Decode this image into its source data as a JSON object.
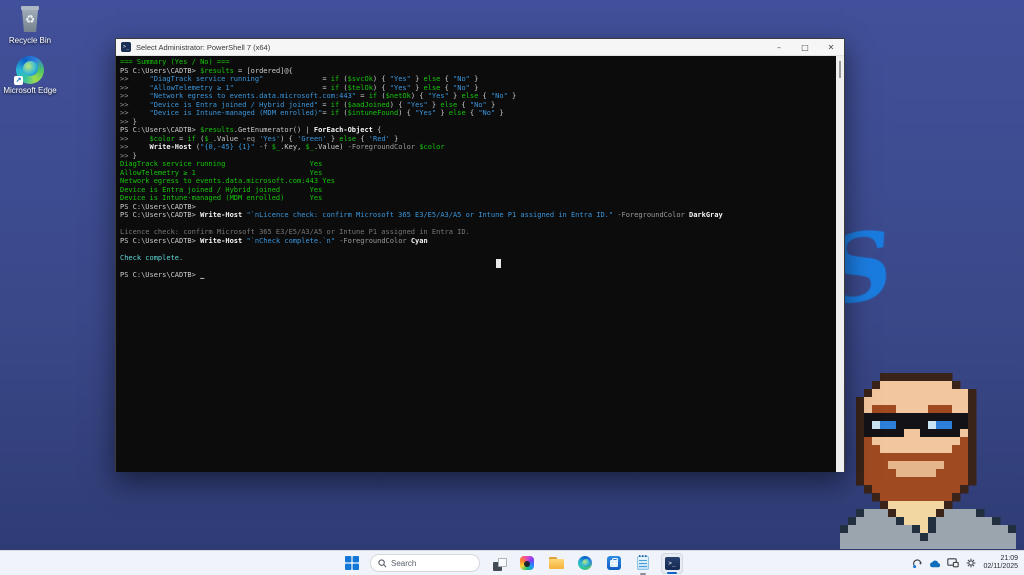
{
  "desktop": {
    "icons": [
      {
        "label": "Recycle Bin"
      },
      {
        "label": "Microsoft Edge"
      }
    ],
    "wallpaper_accent": "#1b7ce0",
    "s_glyph": "S"
  },
  "window": {
    "title": "Select Administrator: PowerShell 7 (x64)",
    "icon_glyph": ">_",
    "controls": {
      "minimize": "–",
      "maximize": "□",
      "close": "✕"
    }
  },
  "terminal": {
    "background": "#0c0c0c",
    "palette": {
      "w": "#cccccc",
      "W": "#f5f5f5",
      "g": "#16c60c",
      "b": "#3a96dd",
      "d": "#9b9b9b",
      "d2": "#767676",
      "c": "#61d6d6"
    },
    "lines": [
      [
        {
          "t": "=== Summary (Yes / No) ===",
          "c": "g"
        }
      ],
      [
        {
          "t": "PS C:\\Users\\CADTB> ",
          "c": "w"
        },
        {
          "t": "$results",
          "c": "g"
        },
        {
          "t": " = [ordered]@{",
          "c": "w"
        }
      ],
      [
        {
          "t": ">>     ",
          "c": "d"
        },
        {
          "t": "\"DiagTrack service running\"",
          "c": "b"
        },
        {
          "t": "              = ",
          "c": "w"
        },
        {
          "t": "if",
          "c": "g"
        },
        {
          "t": " (",
          "c": "w"
        },
        {
          "t": "$svcOk",
          "c": "g"
        },
        {
          "t": ") { ",
          "c": "w"
        },
        {
          "t": "\"Yes\"",
          "c": "b"
        },
        {
          "t": " } ",
          "c": "w"
        },
        {
          "t": "else",
          "c": "g"
        },
        {
          "t": " { ",
          "c": "w"
        },
        {
          "t": "\"No\"",
          "c": "b"
        },
        {
          "t": " }",
          "c": "w"
        }
      ],
      [
        {
          "t": ">>     ",
          "c": "d"
        },
        {
          "t": "\"AllowTelemetry ≥ 1\"",
          "c": "b"
        },
        {
          "t": "                     = ",
          "c": "w"
        },
        {
          "t": "if",
          "c": "g"
        },
        {
          "t": " (",
          "c": "w"
        },
        {
          "t": "$telOk",
          "c": "g"
        },
        {
          "t": ") { ",
          "c": "w"
        },
        {
          "t": "\"Yes\"",
          "c": "b"
        },
        {
          "t": " } ",
          "c": "w"
        },
        {
          "t": "else",
          "c": "g"
        },
        {
          "t": " { ",
          "c": "w"
        },
        {
          "t": "\"No\"",
          "c": "b"
        },
        {
          "t": " }",
          "c": "w"
        }
      ],
      [
        {
          "t": ">>     ",
          "c": "d"
        },
        {
          "t": "\"Network egress to events.data.microsoft.com:443\"",
          "c": "b"
        },
        {
          "t": " = ",
          "c": "w"
        },
        {
          "t": "if",
          "c": "g"
        },
        {
          "t": " (",
          "c": "w"
        },
        {
          "t": "$netOk",
          "c": "g"
        },
        {
          "t": ") { ",
          "c": "w"
        },
        {
          "t": "\"Yes\"",
          "c": "b"
        },
        {
          "t": " } ",
          "c": "w"
        },
        {
          "t": "else",
          "c": "g"
        },
        {
          "t": " { ",
          "c": "w"
        },
        {
          "t": "\"No\"",
          "c": "b"
        },
        {
          "t": " }",
          "c": "w"
        }
      ],
      [
        {
          "t": ">>     ",
          "c": "d"
        },
        {
          "t": "\"Device is Entra joined / Hybrid joined\"",
          "c": "b"
        },
        {
          "t": " = ",
          "c": "w"
        },
        {
          "t": "if",
          "c": "g"
        },
        {
          "t": " (",
          "c": "w"
        },
        {
          "t": "$aadJoined",
          "c": "g"
        },
        {
          "t": ") { ",
          "c": "w"
        },
        {
          "t": "\"Yes\"",
          "c": "b"
        },
        {
          "t": " } ",
          "c": "w"
        },
        {
          "t": "else",
          "c": "g"
        },
        {
          "t": " { ",
          "c": "w"
        },
        {
          "t": "\"No\"",
          "c": "b"
        },
        {
          "t": " }",
          "c": "w"
        }
      ],
      [
        {
          "t": ">>     ",
          "c": "d"
        },
        {
          "t": "\"Device is Intune-managed (MDM enrolled)\"",
          "c": "b"
        },
        {
          "t": "= ",
          "c": "w"
        },
        {
          "t": "if",
          "c": "g"
        },
        {
          "t": " (",
          "c": "w"
        },
        {
          "t": "$intuneFound",
          "c": "g"
        },
        {
          "t": ") { ",
          "c": "w"
        },
        {
          "t": "\"Yes\"",
          "c": "b"
        },
        {
          "t": " } ",
          "c": "w"
        },
        {
          "t": "else",
          "c": "g"
        },
        {
          "t": " { ",
          "c": "w"
        },
        {
          "t": "\"No\"",
          "c": "b"
        },
        {
          "t": " }",
          "c": "w"
        }
      ],
      [
        {
          "t": ">> ",
          "c": "d"
        },
        {
          "t": "}",
          "c": "w"
        }
      ],
      [
        {
          "t": "PS C:\\Users\\CADTB> ",
          "c": "w"
        },
        {
          "t": "$results",
          "c": "g"
        },
        {
          "t": ".GetEnumerator() | ",
          "c": "w"
        },
        {
          "t": "ForEach-Object",
          "c": "W"
        },
        {
          "t": " {",
          "c": "w"
        }
      ],
      [
        {
          "t": ">>     ",
          "c": "d"
        },
        {
          "t": "$color",
          "c": "g"
        },
        {
          "t": " = ",
          "c": "w"
        },
        {
          "t": "if",
          "c": "g"
        },
        {
          "t": " (",
          "c": "w"
        },
        {
          "t": "$_",
          "c": "g"
        },
        {
          "t": ".Value ",
          "c": "w"
        },
        {
          "t": "-eq",
          "c": "d"
        },
        {
          "t": " ",
          "c": "w"
        },
        {
          "t": "'Yes'",
          "c": "b"
        },
        {
          "t": ") { ",
          "c": "w"
        },
        {
          "t": "'Green'",
          "c": "b"
        },
        {
          "t": " } ",
          "c": "w"
        },
        {
          "t": "else",
          "c": "g"
        },
        {
          "t": " { ",
          "c": "w"
        },
        {
          "t": "'Red'",
          "c": "b"
        },
        {
          "t": " }",
          "c": "w"
        }
      ],
      [
        {
          "t": ">>     ",
          "c": "d"
        },
        {
          "t": "Write-Host",
          "c": "W"
        },
        {
          "t": " (",
          "c": "w"
        },
        {
          "t": "\"{0,-45} {1}\"",
          "c": "b"
        },
        {
          "t": " ",
          "c": "w"
        },
        {
          "t": "-f",
          "c": "d"
        },
        {
          "t": " ",
          "c": "w"
        },
        {
          "t": "$_",
          "c": "g"
        },
        {
          "t": ".Key, ",
          "c": "w"
        },
        {
          "t": "$_",
          "c": "g"
        },
        {
          "t": ".Value) ",
          "c": "w"
        },
        {
          "t": "-ForegroundColor",
          "c": "d"
        },
        {
          "t": " ",
          "c": "w"
        },
        {
          "t": "$color",
          "c": "g"
        }
      ],
      [
        {
          "t": ">> ",
          "c": "d"
        },
        {
          "t": "}",
          "c": "w"
        }
      ],
      [
        {
          "t": "DiagTrack service running                    Yes",
          "c": "g"
        }
      ],
      [
        {
          "t": "AllowTelemetry ≥ 1                           Yes",
          "c": "g"
        }
      ],
      [
        {
          "t": "Network egress to events.data.microsoft.com:443 Yes",
          "c": "g"
        }
      ],
      [
        {
          "t": "Device is Entra joined / Hybrid joined       Yes",
          "c": "g"
        }
      ],
      [
        {
          "t": "Device is Intune-managed (MDM enrolled)      Yes",
          "c": "g"
        }
      ],
      [
        {
          "t": "PS C:\\Users\\CADTB> ",
          "c": "w"
        }
      ],
      [
        {
          "t": "PS C:\\Users\\CADTB> ",
          "c": "w"
        },
        {
          "t": "Write-Host",
          "c": "W"
        },
        {
          "t": " ",
          "c": "w"
        },
        {
          "t": "\"`nLicence check: confirm Microsoft 365 E3/E5/A3/A5 or Intune P1 assigned in Entra ID.\"",
          "c": "b"
        },
        {
          "t": " ",
          "c": "w"
        },
        {
          "t": "-ForegroundColor",
          "c": "d"
        },
        {
          "t": " ",
          "c": "w"
        },
        {
          "t": "DarkGray",
          "c": "W"
        }
      ],
      [],
      [
        {
          "t": "Licence check: confirm Microsoft 365 E3/E5/A3/A5 or Intune P1 assigned in Entra ID.",
          "c": "d2"
        }
      ],
      [
        {
          "t": "PS C:\\Users\\CADTB> ",
          "c": "w"
        },
        {
          "t": "Write-Host",
          "c": "W"
        },
        {
          "t": " ",
          "c": "w"
        },
        {
          "t": "\"`nCheck complete.`n\"",
          "c": "b"
        },
        {
          "t": " ",
          "c": "w"
        },
        {
          "t": "-ForegroundColor",
          "c": "d"
        },
        {
          "t": " ",
          "c": "w"
        },
        {
          "t": "Cyan",
          "c": "W"
        }
      ],
      [],
      [
        {
          "t": "Check complete.",
          "c": "c"
        }
      ],
      [],
      [
        {
          "t": "PS C:\\Users\\CADTB> ",
          "c": "w"
        },
        {
          "t": "_",
          "c": "W"
        }
      ]
    ]
  },
  "taskbar": {
    "search_label": "Search",
    "items": [
      "start",
      "search",
      "task-view",
      "photos",
      "file-explorer",
      "edge",
      "microsoft-store",
      "notepad",
      "powershell"
    ],
    "tray": {
      "time": "21:09",
      "date": "02/11/2025"
    }
  },
  "avatar": {
    "alt": "pixel-art portrait: bald man, glasses, red beard, gray sweater",
    "cell": 8,
    "palette": {
      "o": "#3a2318",
      "s": "#f2c69e",
      "b": "#a04a22",
      "m": "#e5b58c",
      "g": "#121217",
      "w": "#c8e4f5",
      "e": "#2e7fd9",
      "n": "#f3d7a2",
      "G": "#9aa5ae",
      "D": "#222f3f"
    },
    "rows": [
      ".....ooooooooo........",
      "....ossssssssso.......",
      "...osssssssssssso.....",
      "..ossssssssssssso.....",
      "..osbbbssssbbbsso.....",
      "..ogggggggggggggo.....",
      "..ogweeggggweeggo.....",
      "..ogggggssgggggso.....",
      "..obsssssssssssbo.....",
      "..obbsssssssssbbo.....",
      "..obbbbbbbbbbbbbo.....",
      "..obbbmmmmmmmbbbo.....",
      "..obbbbmmmmmbbbbo.....",
      "..obbbbbbbbbbbbbo.....",
      "...obbbbbbbbbbbo......",
      "....obbbbbbbbbo.......",
      ".....onnnnnnno........",
      "..DGGGonnnnnoGGGGD....",
      ".DGGGGGDnnnDGGGGGGGD..",
      "DGGGGGGGGDnDGGGGGGGGGD",
      "GGGGGGGGGGDGGGGGGGGGGG",
      "GGGGGGGGGGGGGGGGGGGGGG"
    ]
  }
}
